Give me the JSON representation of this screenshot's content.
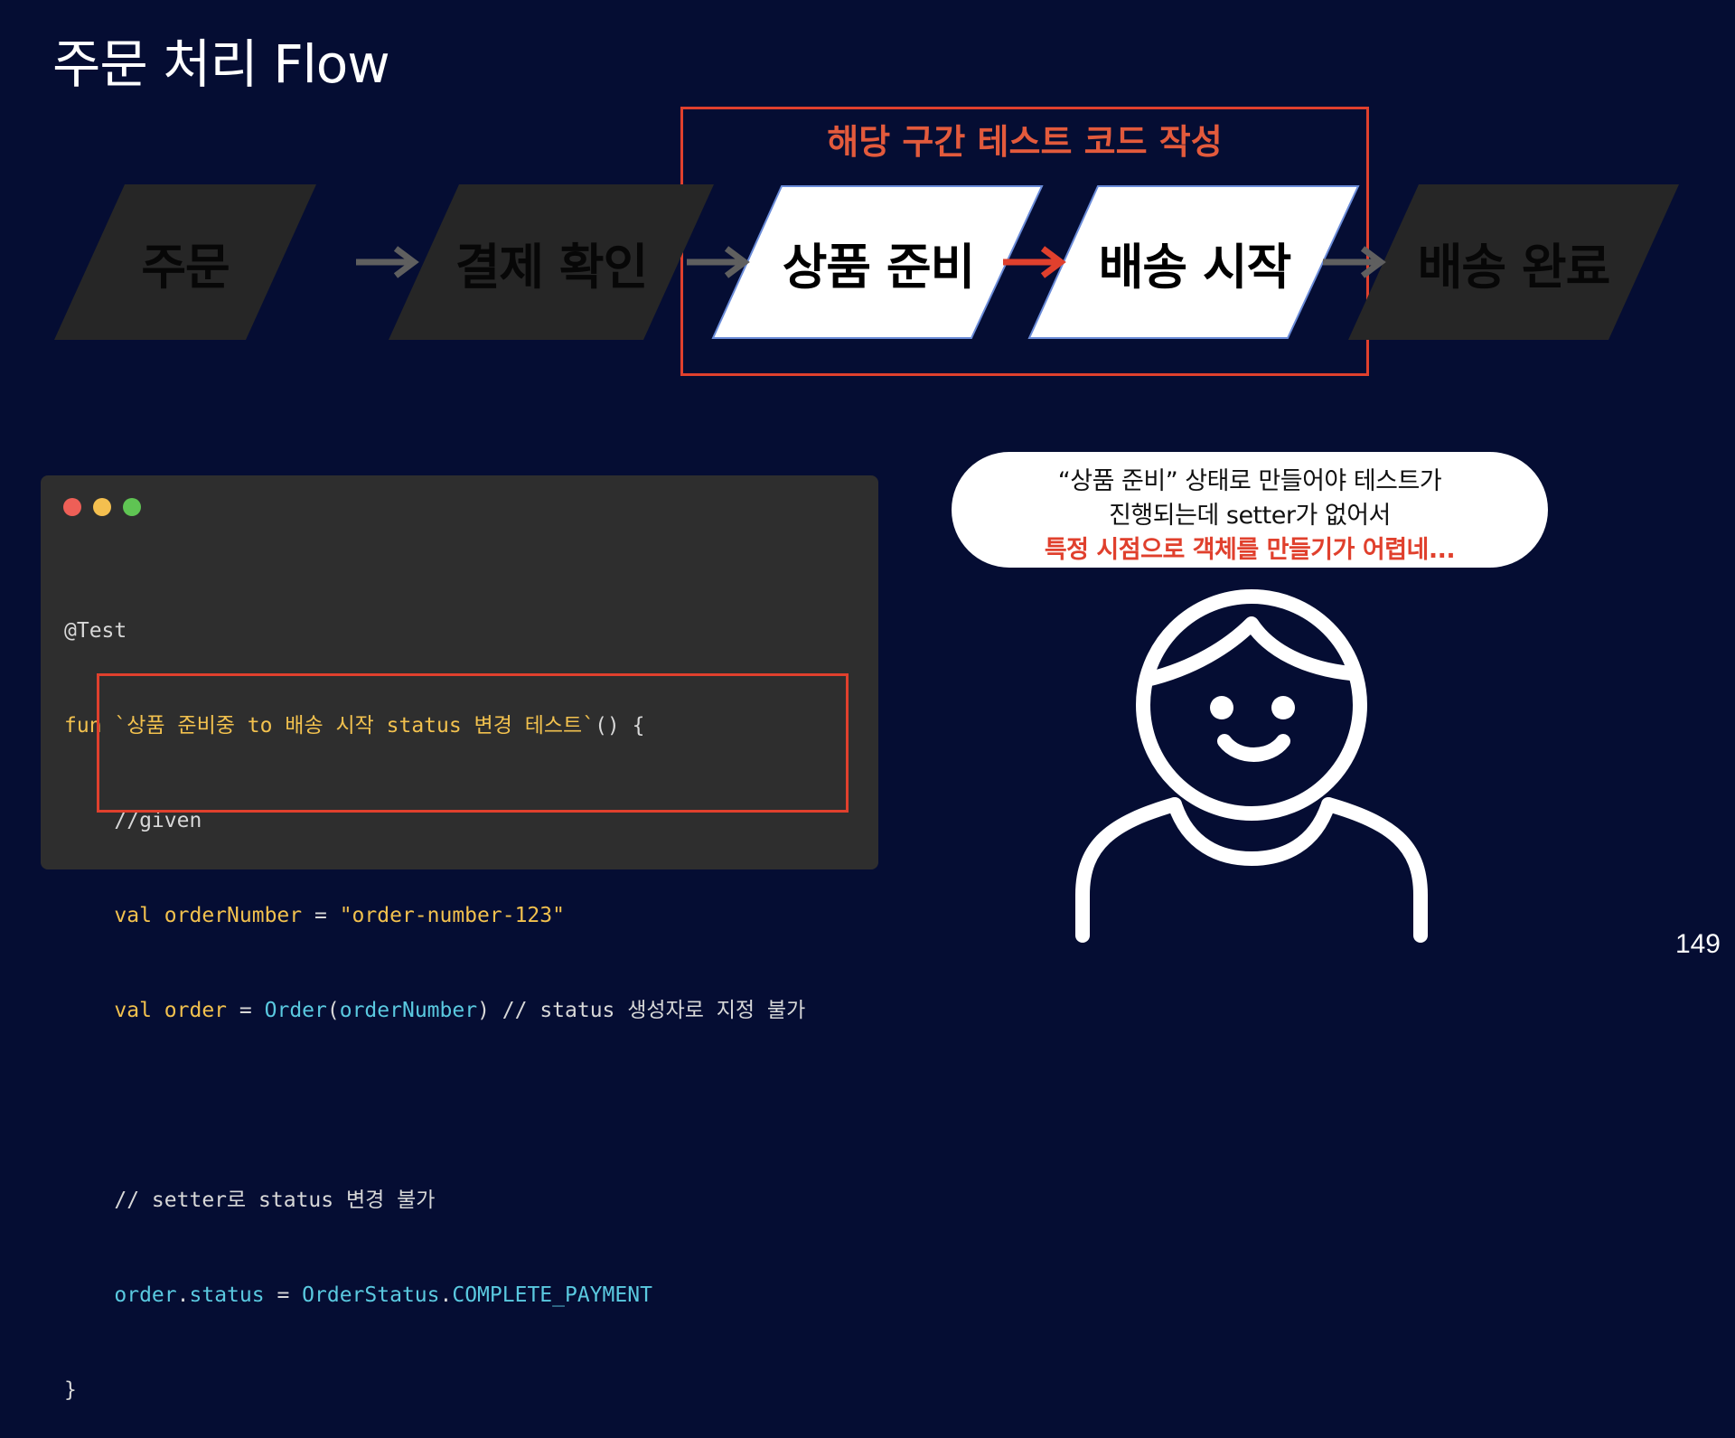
{
  "title": "주문 처리 Flow",
  "focus_label": "해당 구간 테스트 코드 작성",
  "flow_steps": [
    {
      "label": "주문",
      "state": "dim"
    },
    {
      "label": "결제 확인",
      "state": "dim"
    },
    {
      "label": "상품 준비",
      "state": "active"
    },
    {
      "label": "배송 시작",
      "state": "active"
    },
    {
      "label": "배송 완료",
      "state": "dim"
    }
  ],
  "code": {
    "line1": "@Test",
    "line2_kw": "fun",
    "line2_name": "`상품 준비중 to 배송 시작 status 변경 테스트`",
    "line2_rest": "() {",
    "line3": "//given",
    "line4_kw": "val",
    "line4_name": "orderNumber",
    "line4_eq": "=",
    "line4_str": "\"order-number-123\"",
    "line5_kw": "val",
    "line5_name": "order",
    "line5_eq": "=",
    "line5_type": "Order",
    "line5_arg": "orderNumber",
    "line5_comment": "// status 생성자로 지정 불가",
    "line7_comment": "// setter로 status 변경 불가",
    "line8_obj": "order",
    "line8_prop": "status",
    "line8_eq": "=",
    "line8_type": "OrderStatus",
    "line8_const": "COMPLETE_PAYMENT",
    "line9": "}"
  },
  "speech_bubble": {
    "line1": "“상품 준비” 상태로 만들어야 테스트가",
    "line2": "진행되는데 setter가 없어서",
    "line3": "특정 시점으로 객체를 만들기가 어렵네..."
  },
  "page_number": "149",
  "colors": {
    "background": "#050d33",
    "accent_red": "#e0402d",
    "dim_step": "#262626",
    "active_step": "#ffffff",
    "code_bg": "#2e2e2e"
  },
  "icons": {
    "window_controls": [
      "red-dot",
      "yellow-dot",
      "green-dot"
    ],
    "person": "person-icon",
    "arrow": "arrow-right-icon"
  }
}
